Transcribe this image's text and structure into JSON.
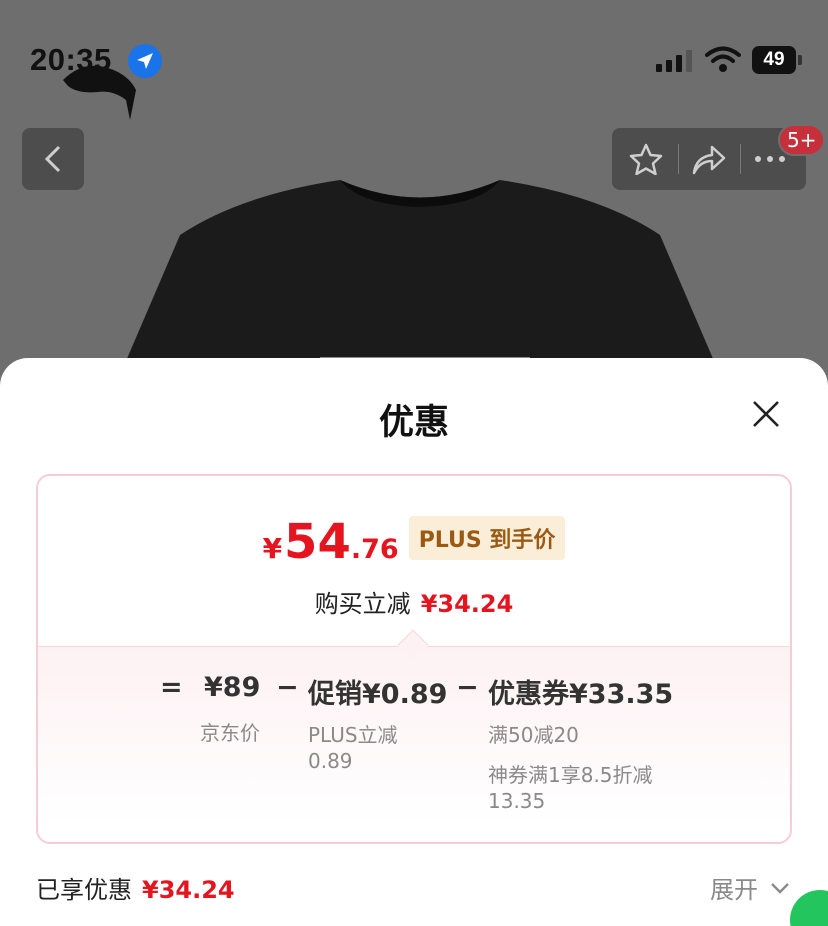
{
  "status_bar": {
    "time": "20:35",
    "battery": "49"
  },
  "header": {
    "badge": "5+"
  },
  "sheet": {
    "title": "优惠",
    "final_price": {
      "currency": "¥",
      "integer": "54",
      "decimal": ".76"
    },
    "plus_tag": "PLUS 到手价",
    "purchase_reduce_label": "购买立减",
    "purchase_reduce_value": "¥34.24",
    "formula": {
      "equals": "=",
      "jd_price": "¥89",
      "jd_price_label": "京东价",
      "minus1": "−",
      "promo": "促销¥0.89",
      "promo_detail": [
        "PLUS立减",
        "0.89"
      ],
      "minus2": "−",
      "coupon": "优惠券¥33.35",
      "coupon_detail": [
        "满50减20",
        "神券满1享8.5折减",
        "13.35"
      ]
    },
    "footer": {
      "enjoyed_label": "已享优惠",
      "enjoyed_value": "¥34.24",
      "expand_label": "展开"
    }
  },
  "colors": {
    "accent_red": "#e4151f",
    "tag_bg": "#fbeed8",
    "tag_text": "#9a5a14"
  }
}
